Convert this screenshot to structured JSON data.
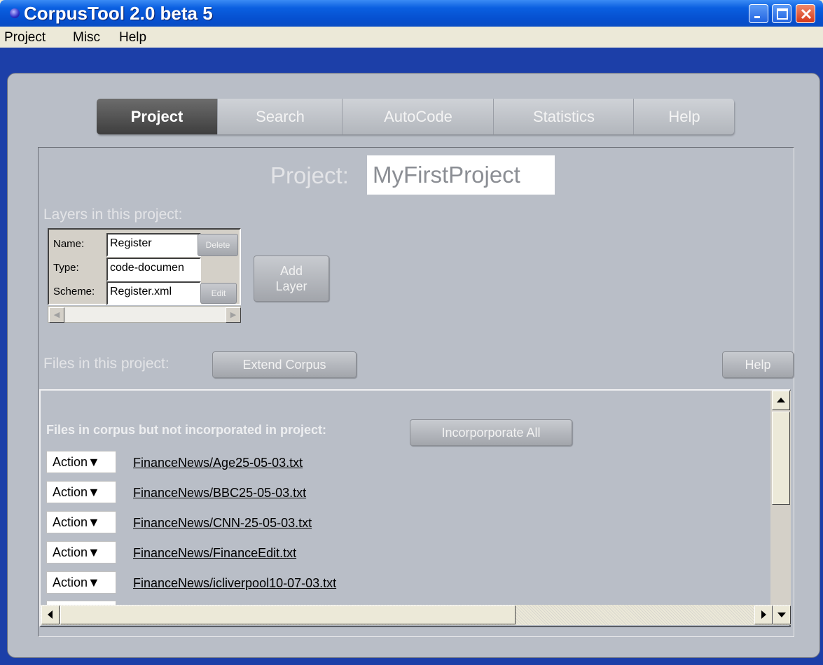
{
  "window": {
    "title": "CorpusTool 2.0 beta 5",
    "title_color": "#0a5fe0"
  },
  "menu": [
    "Project",
    "Misc",
    "Help"
  ],
  "tabs": [
    {
      "label": "Project",
      "active": true
    },
    {
      "label": "Search",
      "active": false
    },
    {
      "label": "AutoCode",
      "active": false
    },
    {
      "label": "Statistics",
      "active": false
    },
    {
      "label": "Help",
      "active": false
    }
  ],
  "project": {
    "label": "Project:",
    "name": "MyFirstProject"
  },
  "layers": {
    "heading": "Layers in this project:",
    "name_label": "Name:",
    "name_value": "Register",
    "delete_label": "Delete",
    "type_label": "Type:",
    "type_value": "code-documen",
    "scheme_label": "Scheme:",
    "scheme_value": "Register.xml",
    "edit_label": "Edit",
    "add_layer_line1": "Add",
    "add_layer_line2": "Layer"
  },
  "files": {
    "heading": "Files in this project:",
    "extend_label": "Extend Corpus",
    "help_label": "Help",
    "unincorporated_label": "Files in corpus but not incorporated in project:",
    "incorporate_all_label": "Incorporporate All",
    "action_label": "Action",
    "items": [
      "FinanceNews/Age25-05-03.txt",
      "FinanceNews/BBC25-05-03.txt",
      "FinanceNews/CNN-25-05-03.txt",
      "FinanceNews/FinanceEdit.txt",
      "FinanceNews/icliverpool10-07-03.txt"
    ]
  }
}
